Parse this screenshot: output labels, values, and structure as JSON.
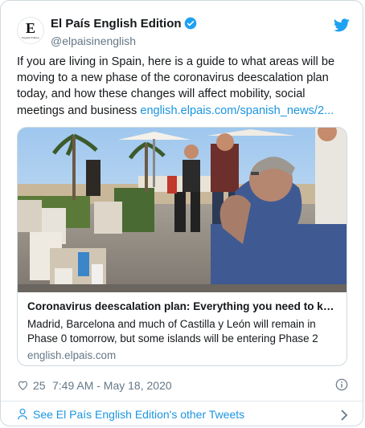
{
  "colors": {
    "accent": "#1b95e0",
    "muted": "#657786",
    "text": "#14171a",
    "border": "#cfd9de"
  },
  "account": {
    "display_name": "El País English Edition",
    "handle": "@elpaisinenglish",
    "avatar_letter": "E",
    "avatar_subtext": "English Edition",
    "verified_icon": "verified-badge-icon",
    "platform_icon": "twitter-bird-icon"
  },
  "tweet": {
    "text": "If you are living in Spain, here is a guide to what areas will be moving to a new phase of the coronavirus deescalation plan today, and how these changes will affect mobility, social meetings and business ",
    "link_text": "english.elpais.com/spanish_news/2..."
  },
  "link_card": {
    "image_description": "photo-cafe-terrace",
    "title": "Coronavirus deescalation plan: Everything you need to know ...",
    "description": "Madrid, Barcelona and much of Castilla y León will remain in Phase 0 tomorrow, but some islands will be entering Phase 2",
    "domain": "english.elpais.com"
  },
  "meta": {
    "likes": "25",
    "timestamp": "7:49 AM - May 18, 2020",
    "like_icon": "heart-icon",
    "info_icon": "info-icon"
  },
  "footer": {
    "see_more": "See El País English Edition's other Tweets",
    "person_icon": "person-icon",
    "chevron_icon": "chevron-right-icon"
  }
}
